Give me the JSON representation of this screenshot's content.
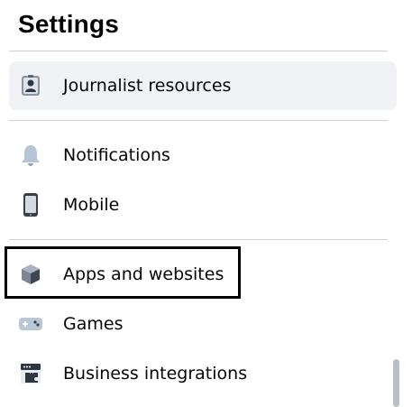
{
  "page": {
    "title": "Settings"
  },
  "menu": {
    "journalist_resources": "Journalist resources",
    "notifications": "Notifications",
    "mobile": "Mobile",
    "apps_and_websites": "Apps and websites",
    "games": "Games",
    "business_integrations": "Business integrations"
  },
  "icons": {
    "journalist_resources": "id-badge-icon",
    "notifications": "bell-icon",
    "mobile": "phone-icon",
    "apps_and_websites": "cube-icon",
    "games": "gamepad-icon",
    "business_integrations": "puzzle-piece-icon"
  },
  "colors": {
    "active_background": "#f0f2f5",
    "divider": "#ced0d4",
    "highlight_border": "#000000",
    "text": "#050505"
  }
}
